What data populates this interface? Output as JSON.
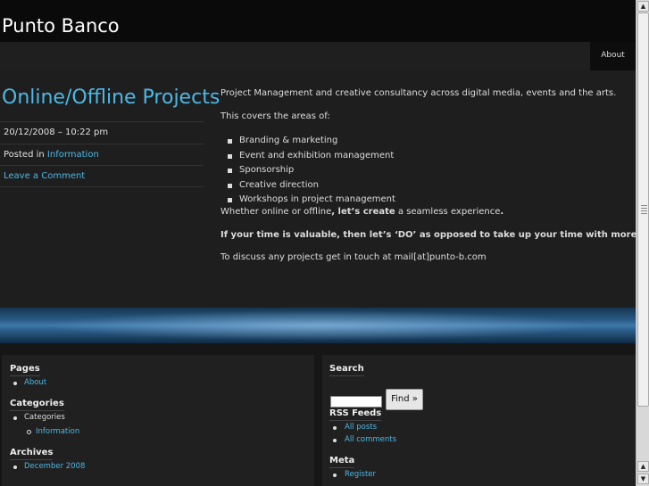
{
  "site": {
    "title": "Punto Banco"
  },
  "nav": {
    "about": "About"
  },
  "post": {
    "title": "Online/Offline Projects",
    "date": "20/12/2008 – 10:22 pm",
    "posted_in_prefix": "Posted in ",
    "category": "Information",
    "comment_link": "Leave a Comment",
    "paragraphs": {
      "intro": "Project Management and creative consultancy across digital media, events and the arts.",
      "covers": "This covers the areas of:",
      "whether_pre": "Whether online or offline",
      "whether_bold": ", let’s create",
      "whether_post": " a seamless experience",
      "whether_end": ".",
      "valuable": "If your time is valuable, then let’s ‘DO’ as opposed to take up your time with more words.",
      "contact": "To discuss any projects get in touch at mail[at]punto-b.com"
    },
    "areas": [
      "Branding & marketing",
      "Event and exhibition management",
      "Sponsorship",
      "Creative direction",
      "Workshops in project management"
    ]
  },
  "sidebar_left": {
    "pages_title": "Pages",
    "pages": [
      "About"
    ],
    "categories_title": "Categories",
    "categories_parent": "Categories",
    "categories_child": "Information",
    "archives_title": "Archives",
    "archives": [
      "December 2008"
    ]
  },
  "sidebar_right": {
    "search_title": "Search",
    "find_button": "Find »",
    "rss_title": "RSS Feeds",
    "rss": [
      "All posts",
      "All comments"
    ],
    "meta_title": "Meta",
    "meta": [
      "Register"
    ]
  },
  "colors": {
    "link": "#4cb8e6",
    "background": "#262626",
    "band": "#3e79ab"
  },
  "scrollbar": {
    "up_icon": "arrow-up-icon",
    "down_icon": "arrow-down-icon"
  }
}
